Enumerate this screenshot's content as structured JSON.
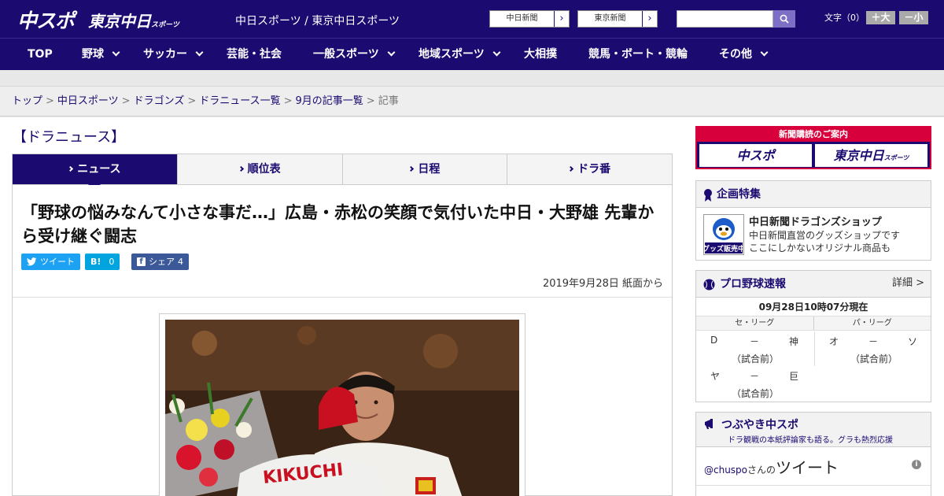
{
  "header": {
    "logo_chuspo": "中スポ",
    "logo_tokyo": "東京中日",
    "logo_tokyo_small": "スポーツ",
    "site_name": "中日スポーツ / 東京中日スポーツ",
    "paper_buttons": [
      {
        "label": "中日新聞"
      },
      {
        "label": "東京新聞"
      }
    ],
    "search": {
      "placeholder": "",
      "value": ""
    },
    "font_size": {
      "label": "文字（0）",
      "plus": "＋大",
      "minus": "－小"
    }
  },
  "nav": [
    {
      "label": "TOP",
      "has_menu": false
    },
    {
      "label": "野球",
      "has_menu": true
    },
    {
      "label": "サッカー",
      "has_menu": true
    },
    {
      "label": "芸能・社会",
      "has_menu": false
    },
    {
      "label": "一般スポーツ",
      "has_menu": true
    },
    {
      "label": "地域スポーツ",
      "has_menu": true
    },
    {
      "label": "大相撲",
      "has_menu": false
    },
    {
      "label": "競馬・ボート・競輪",
      "has_menu": false
    },
    {
      "label": "その他",
      "has_menu": true
    }
  ],
  "breadcrumb": {
    "items": [
      "トップ",
      "中日スポーツ",
      "ドラゴンズ",
      "ドラニュース一覧",
      "9月の記事一覧"
    ],
    "current": "記事",
    "separator": ">"
  },
  "section_title": "【ドラニュース】",
  "tabs": [
    {
      "label": "ニュース",
      "active": true
    },
    {
      "label": "順位表",
      "active": false
    },
    {
      "label": "日程",
      "active": false
    },
    {
      "label": "ドラ番",
      "active": false
    }
  ],
  "article": {
    "headline": "「野球の悩みなんて小さな事だ…」広島・赤松の笑顔で気付いた中日・大野雄 先輩から受け継ぐ闘志",
    "share": {
      "tweet": "ツイート",
      "hatena": "B!",
      "hatena_count": "0",
      "facebook": "シェア",
      "facebook_count": "4"
    },
    "date": "2019年9月28日 紙面から",
    "photo_text": "KIKUCHI"
  },
  "sidebar": {
    "ad": {
      "top": "新聞購読のご案内",
      "logo1": "中スポ",
      "logo2": "東京中日",
      "logo2_small": "スポーツ"
    },
    "feature": {
      "title": "企画特集",
      "shop_title": "中日新聞ドラゴンズショップ",
      "shop_desc1": "中日新聞直営のグッズショップです",
      "shop_desc2": "ここにしかないオリジナル商品も",
      "shop_badge": "グッズ販売中"
    },
    "scores": {
      "title": "プロ野球速報",
      "more": "詳細 >",
      "time": "09月28日10時07分現在",
      "leagues": [
        "セ・リーグ",
        "パ・リーグ"
      ],
      "games": [
        {
          "home": "D",
          "sep": "－",
          "away": "神",
          "status": "（試合前）"
        },
        {
          "home": "オ",
          "sep": "－",
          "away": "ソ",
          "status": "（試合前）"
        },
        {
          "home": "ヤ",
          "sep": "－",
          "away": "巨",
          "status": "（試合前）"
        }
      ]
    },
    "twitter": {
      "title": "つぶやき中スポ",
      "subtitle": "ドラ観戦の本紙評論家も語る。グラも熱烈応援",
      "handle": "@chuspo",
      "san_no": "さんの",
      "tweet_word": "ツイート"
    }
  },
  "colors": {
    "brand": "#1b0a70",
    "accent_red": "#d8003c",
    "twitter": "#1da1f2",
    "hatena": "#00a4de",
    "facebook": "#3b5998"
  }
}
